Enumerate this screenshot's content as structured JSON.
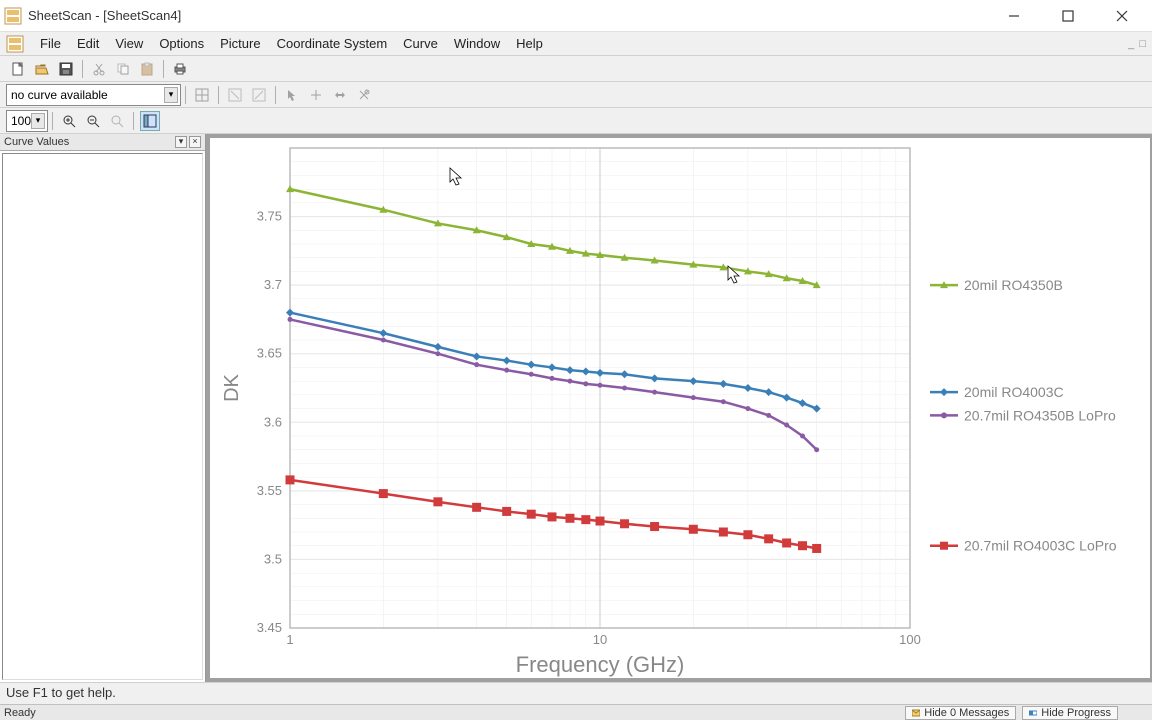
{
  "window": {
    "title": "SheetScan - [SheetScan4]"
  },
  "menu": {
    "items": [
      "File",
      "Edit",
      "View",
      "Options",
      "Picture",
      "Coordinate System",
      "Curve",
      "Window",
      "Help"
    ]
  },
  "toolbar1_tooltips": [
    "New",
    "Open",
    "Save",
    "Cut",
    "Copy",
    "Paste",
    "Print"
  ],
  "curve_combo": {
    "value": "no curve available"
  },
  "zoom_combo": {
    "value": "100"
  },
  "side_panel": {
    "title": "Curve Values"
  },
  "hint": "Use F1 to get help.",
  "status": {
    "left": "Ready",
    "hide_messages": "Hide 0 Messages",
    "hide_progress": "Hide Progress"
  },
  "chart_data": {
    "type": "line",
    "xlabel": "Frequency (GHz)",
    "ylabel": "DK",
    "xscale": "log",
    "xlim": [
      1,
      100
    ],
    "ylim": [
      3.45,
      3.8
    ],
    "xticks": [
      1,
      10,
      100
    ],
    "yticks": [
      3.45,
      3.5,
      3.55,
      3.6,
      3.65,
      3.7,
      3.75
    ],
    "x": [
      1,
      2,
      3,
      4,
      5,
      6,
      7,
      8,
      9,
      10,
      12,
      15,
      20,
      25,
      30,
      35,
      40,
      45,
      50
    ],
    "series": [
      {
        "name": "20mil RO4350B",
        "color": "#8cb536",
        "values": [
          3.77,
          3.755,
          3.745,
          3.74,
          3.735,
          3.73,
          3.728,
          3.725,
          3.723,
          3.722,
          3.72,
          3.718,
          3.715,
          3.713,
          3.71,
          3.708,
          3.705,
          3.703,
          3.7
        ]
      },
      {
        "name": "20mil RO4003C",
        "color": "#3b7fb8",
        "values": [
          3.68,
          3.665,
          3.655,
          3.648,
          3.645,
          3.642,
          3.64,
          3.638,
          3.637,
          3.636,
          3.635,
          3.632,
          3.63,
          3.628,
          3.625,
          3.622,
          3.618,
          3.614,
          3.61
        ]
      },
      {
        "name": "20.7mil RO4350B LoPro",
        "color": "#8a5aa5",
        "values": [
          3.675,
          3.66,
          3.65,
          3.642,
          3.638,
          3.635,
          3.632,
          3.63,
          3.628,
          3.627,
          3.625,
          3.622,
          3.618,
          3.615,
          3.61,
          3.605,
          3.598,
          3.59,
          3.58
        ]
      },
      {
        "name": "20.7mil RO4003C LoPro",
        "color": "#d13b3b",
        "values": [
          3.558,
          3.548,
          3.542,
          3.538,
          3.535,
          3.533,
          3.531,
          3.53,
          3.529,
          3.528,
          3.526,
          3.524,
          3.522,
          3.52,
          3.518,
          3.515,
          3.512,
          3.51,
          3.508
        ]
      }
    ],
    "legend_positions_y": [
      3.7,
      3.622,
      3.605,
      3.51
    ]
  }
}
